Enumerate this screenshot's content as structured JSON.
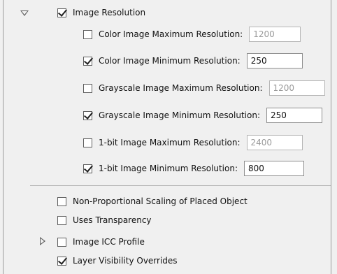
{
  "image_resolution": {
    "label": "Image Resolution",
    "checked": true,
    "expanded": true,
    "items": [
      {
        "label": "Color Image Maximum Resolution:",
        "checked": false,
        "value": "1200",
        "enabled": false
      },
      {
        "label": "Color Image Minimum Resolution:",
        "checked": true,
        "value": "250",
        "enabled": true
      },
      {
        "label": "Grayscale Image Maximum Resolution:",
        "checked": false,
        "value": "1200",
        "enabled": false
      },
      {
        "label": "Grayscale Image Minimum Resolution:",
        "checked": true,
        "value": "250",
        "enabled": true
      },
      {
        "label": "1-bit Image Maximum Resolution:",
        "checked": false,
        "value": "2400",
        "enabled": false
      },
      {
        "label": "1-bit Image Minimum Resolution:",
        "checked": true,
        "value": "800",
        "enabled": true
      }
    ]
  },
  "options": [
    {
      "label": "Non-Proportional Scaling of Placed Object",
      "checked": false
    },
    {
      "label": "Uses Transparency",
      "checked": false
    },
    {
      "label": "Image ICC Profile",
      "checked": false,
      "expanded": false
    },
    {
      "label": "Layer Visibility Overrides",
      "checked": true
    }
  ],
  "colors": {
    "background": "#f0f0f0",
    "border": "#9c9c9c"
  }
}
